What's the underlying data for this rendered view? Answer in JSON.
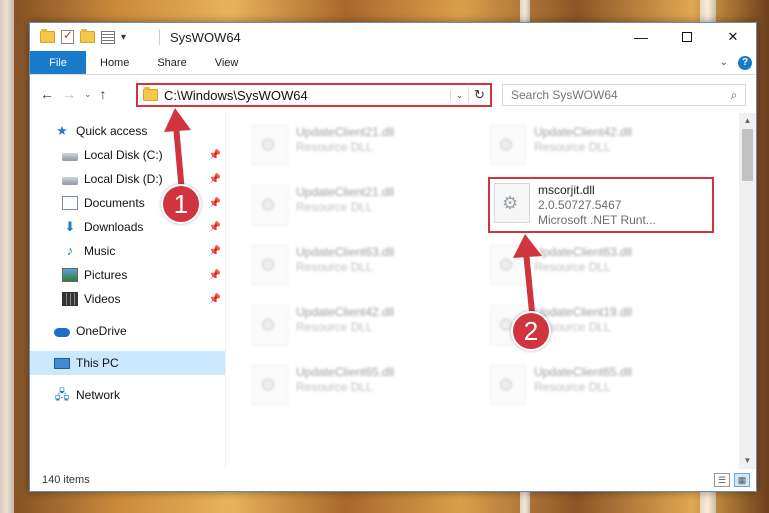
{
  "window": {
    "title": "SysWOW64",
    "controls": {
      "minimize": "—",
      "maximize": "",
      "close": "✕"
    }
  },
  "ribbon": {
    "tabs": [
      "File",
      "Home",
      "Share",
      "View"
    ],
    "expand_icon": "chevron-down-icon",
    "help": "?"
  },
  "navigation": {
    "back": "←",
    "forward": "→",
    "recent": "⌄",
    "up": "↑"
  },
  "address_bar": {
    "path": "C:\\Windows\\SysWOW64",
    "dropdown": "⌄",
    "refresh": "↻"
  },
  "search": {
    "placeholder": "Search SysWOW64",
    "icon": "search-icon"
  },
  "sidebar": {
    "quick_access": "Quick access",
    "pinned": [
      {
        "label": "Local Disk (C:)",
        "icon": "disk-icon"
      },
      {
        "label": "Local Disk (D:)",
        "icon": "disk-icon"
      },
      {
        "label": "Documents",
        "icon": "documents-icon"
      },
      {
        "label": "Downloads",
        "icon": "downloads-icon"
      },
      {
        "label": "Music",
        "icon": "music-icon"
      },
      {
        "label": "Pictures",
        "icon": "pictures-icon"
      },
      {
        "label": "Videos",
        "icon": "videos-icon"
      }
    ],
    "onedrive": "OneDrive",
    "this_pc": "This PC",
    "network": "Network"
  },
  "files": [
    {
      "name": "UpdateClient21.dll",
      "sub": "Resource DLL",
      "blurred": true
    },
    {
      "name": "UpdateClient42.dll",
      "sub": "Resource DLL",
      "blurred": true
    },
    {
      "name": "UpdateClient21.dll",
      "sub": "Resource DLL",
      "blurred": true
    },
    {
      "name": "mscorjit.dll",
      "version": "2.0.50727.5467",
      "company": "Microsoft .NET Runt...",
      "blurred": false
    },
    {
      "name": "UpdateClient63.dll",
      "sub": "Resource DLL",
      "blurred": true
    },
    {
      "name": "UpdateClient63.dll",
      "sub": "Resource DLL",
      "blurred": true
    },
    {
      "name": "UpdateClient42.dll",
      "sub": "Resource DLL",
      "blurred": true
    },
    {
      "name": "UpdateClient19.dll",
      "sub": "Resource DLL",
      "blurred": true
    },
    {
      "name": "UpdateClient65.dll",
      "sub": "Resource DLL",
      "blurred": true
    },
    {
      "name": "UpdateClient65.dll",
      "sub": "Resource DLL",
      "blurred": true
    }
  ],
  "status": {
    "item_count": "140 items"
  },
  "callouts": [
    "1",
    "2"
  ],
  "colors": {
    "accent": "#1979ca",
    "highlight": "#d0353f",
    "selection": "#cce8ff"
  }
}
